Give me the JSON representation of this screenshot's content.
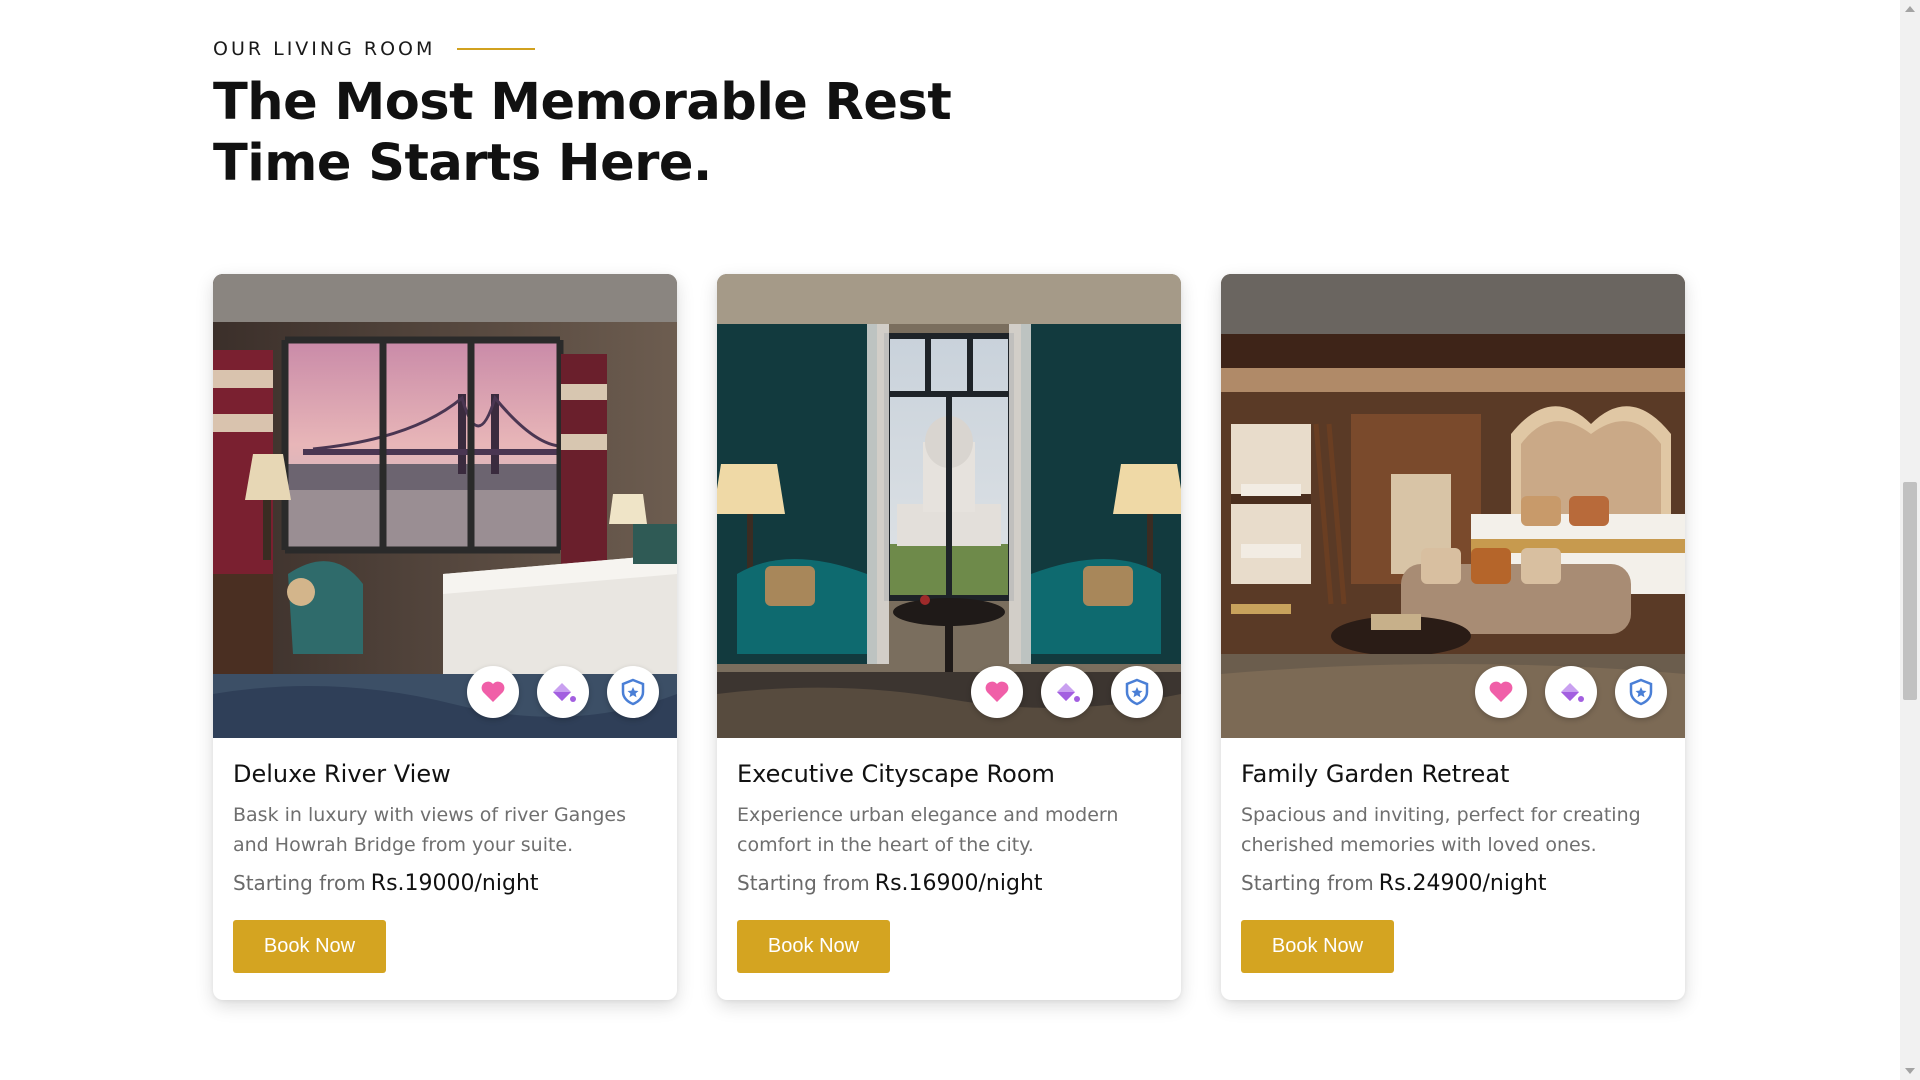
{
  "section": {
    "eyebrow": "OUR LIVING ROOM",
    "headline_line1": "The Most Memorable Rest",
    "headline_line2": "Time Starts Here.",
    "accent_color": "#d4a421"
  },
  "rooms": [
    {
      "title": "Deluxe River View",
      "description": "Bask in luxury with views of river Ganges and Howrah Bridge from your suite.",
      "price_label": "Starting from",
      "price": "Rs.19000/night",
      "button": "Book Now",
      "image": "hotel-room-river-bridge-view"
    },
    {
      "title": "Executive Cityscape Room",
      "description": "Experience urban elegance and modern comfort in the heart of the city.",
      "price_label": "Starting from",
      "price": "Rs.16900/night",
      "button": "Book Now",
      "image": "hotel-room-memorial-view"
    },
    {
      "title": "Family Garden Retreat",
      "description": "Spacious and inviting, perfect for creating cherished memories with loved ones.",
      "price_label": "Starting from",
      "price": "Rs.24900/night",
      "button": "Book Now",
      "image": "family-suite-with-bunk-beds"
    }
  ],
  "badge_icons": [
    "heart-icon",
    "paint-bucket-icon",
    "shield-star-icon"
  ],
  "badge_colors": {
    "heart": "#f05fa8",
    "bucket": "#b06ee0",
    "shield": "#4a7fd6"
  }
}
